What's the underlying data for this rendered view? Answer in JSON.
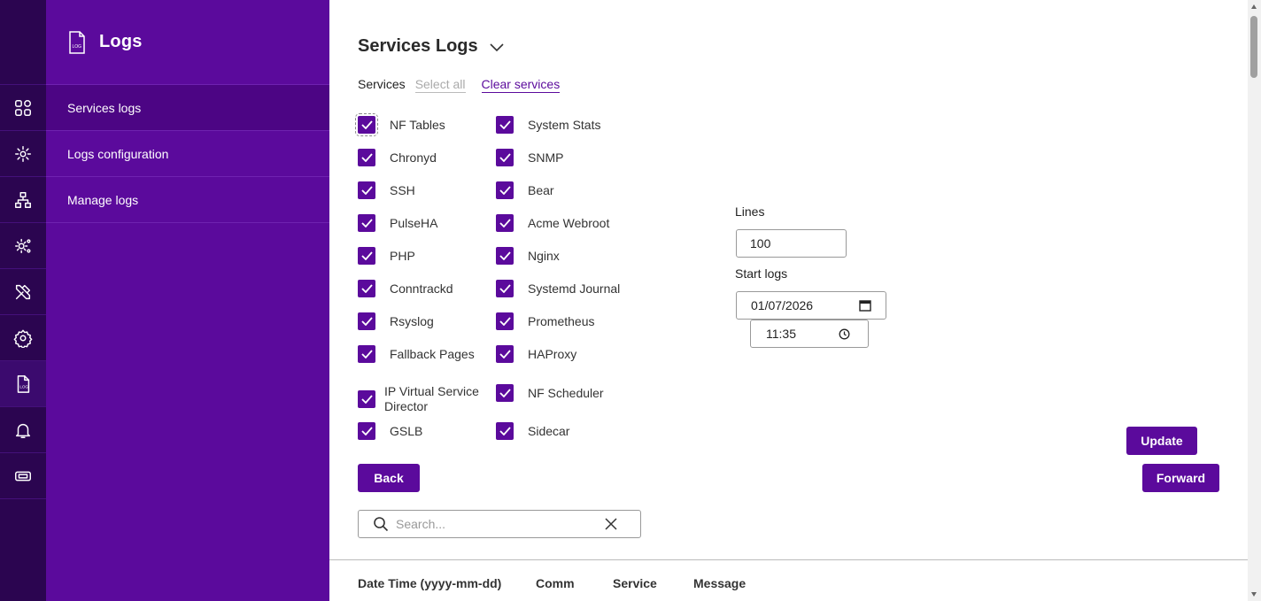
{
  "sidebar": {
    "title": "Logs",
    "items": [
      {
        "label": "Services logs",
        "active": true
      },
      {
        "label": "Logs configuration",
        "active": false
      },
      {
        "label": "Manage logs",
        "active": false
      }
    ]
  },
  "rail": {
    "icons": [
      "dashboard-icon",
      "cluster-settings-icon",
      "network-icon",
      "services-settings-icon",
      "tools-icon",
      "settings-icon",
      "log-file-icon",
      "bell-icon",
      "ticket-icon"
    ],
    "active": "log-file-icon"
  },
  "main": {
    "title": "Services Logs",
    "services_label": "Services",
    "select_all": "Select all",
    "clear_services": "Clear services",
    "services_left": [
      "NF Tables",
      "Chronyd",
      "SSH",
      "PulseHA",
      "PHP",
      "Conntrackd",
      "Rsyslog",
      "Fallback Pages",
      "IP Virtual Service Director",
      "GSLB"
    ],
    "services_right": [
      "System Stats",
      "SNMP",
      "Bear",
      "Acme Webroot",
      "Nginx",
      "Systemd Journal",
      "Prometheus",
      "HAProxy",
      "NF Scheduler",
      "Sidecar"
    ],
    "all_checked": true,
    "lines_label": "Lines",
    "lines_value": "100",
    "start_logs_label": "Start logs",
    "start_date": "01/07/2026",
    "start_time": "11:35",
    "update_button": "Update",
    "back_button": "Back",
    "forward_button": "Forward",
    "search_placeholder": "Search...",
    "table_headers": [
      "Date Time (yyyy-mm-dd)",
      "Comm",
      "Service",
      "Message"
    ]
  },
  "colors": {
    "rail_bg": "#2b0550",
    "sidebar_bg": "#5b0a9c",
    "accent": "#5b0a9c"
  }
}
